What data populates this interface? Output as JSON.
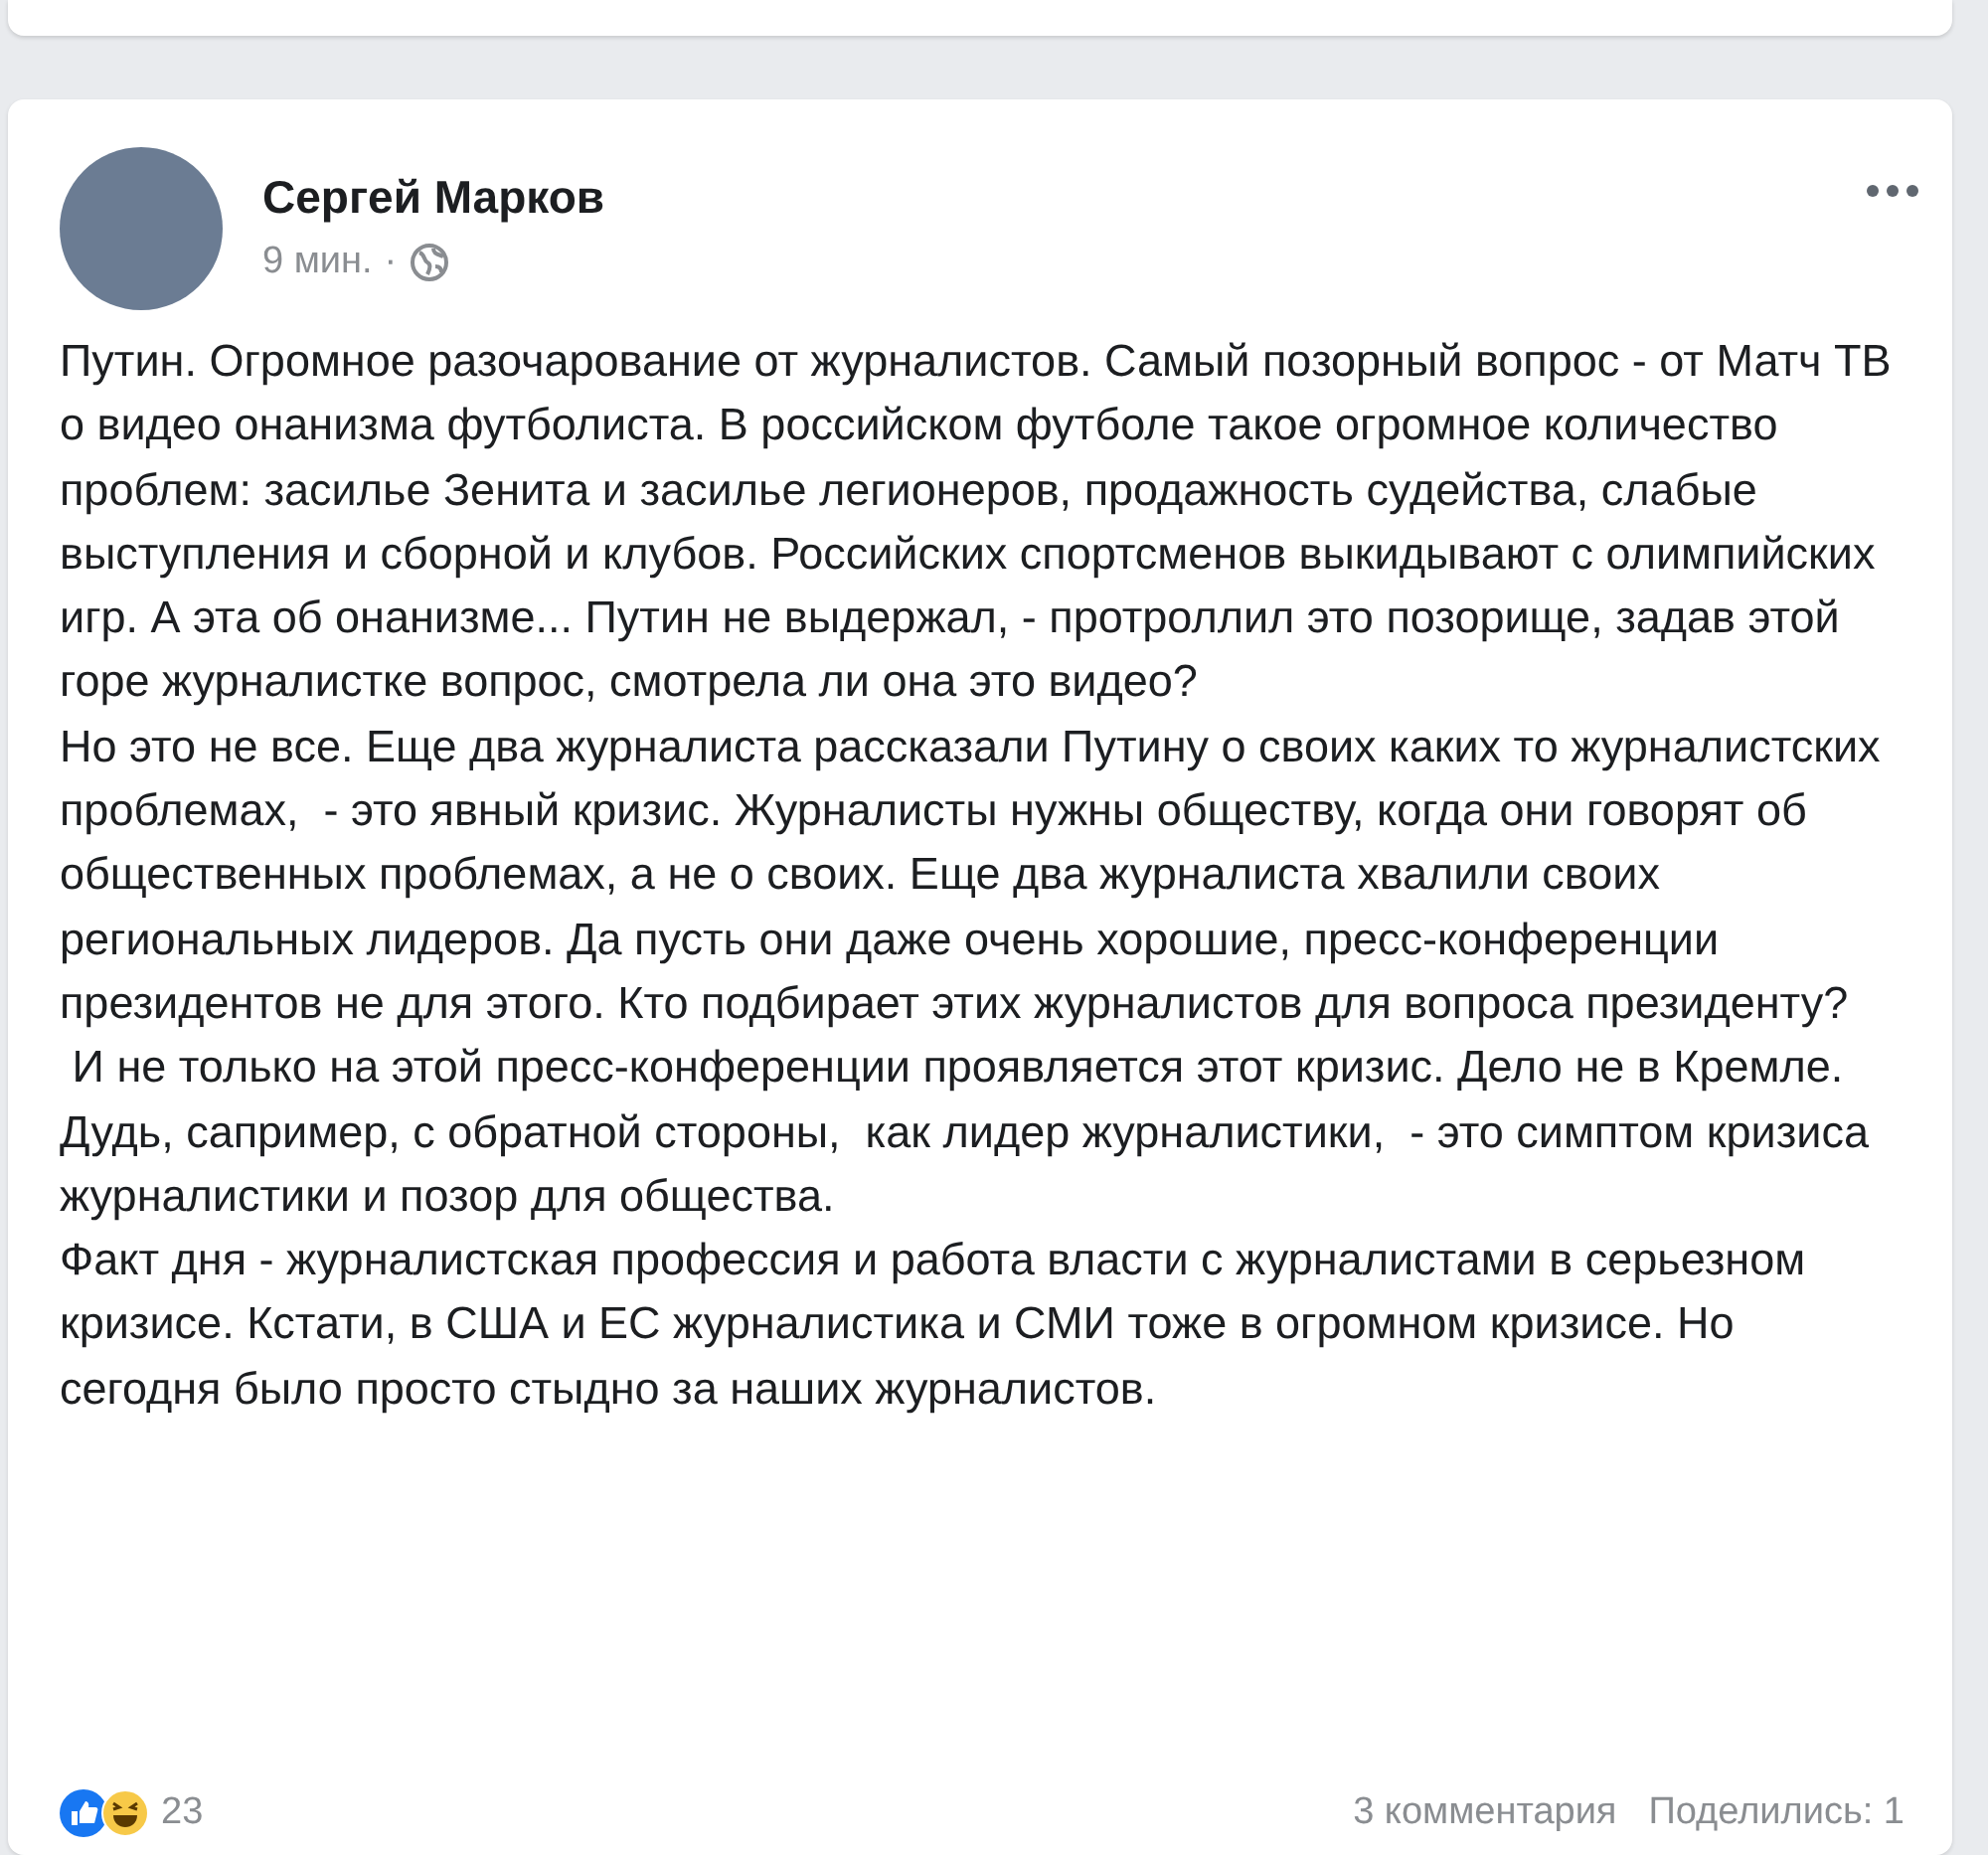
{
  "post": {
    "author": "Сергей Марков",
    "time": "9 мин.",
    "separator": "·",
    "paragraphs": [
      "Путин. Огромное разочарование от журналистов. Самый позорный вопрос - от Матч ТВ о видео онанизма футболиста. В российском футболе такое огромное количество проблем: засилье Зенита и засилье легионеров, продажность судейства, слабые выступления и сборной и клубов. Российских спортсменов выкидывают с олимпийских игр. А эта об онанизме... Путин не выдержал, - протроллил это позорище, задав этой горе журналистке вопрос, смотрела ли она это видео?",
      "Но это не все. Еще два журналиста рассказали Путину о своих каких то журналистских проблемах,  - это явный кризис. Журналисты нужны обществу, когда они говорят об общественных проблемах, а не о своих. Еще два журналиста хвалили своих региональных лидеров. Да пусть они даже очень хорошие, пресс-конференции президентов не для этого. Кто подбирает этих журналистов для вопроса президенту?",
      " И не только на этой пресс-конференции проявляется этот кризис. Дело не в Кремле. Дудь, сапример, с обратной стороны,  как лидер журналистики,  - это симптом кризиса журналистики и позор для общества.",
      "Факт дня - журналистская профессия и работа власти с журналистами в серьезном кризисе. Кстати, в США и ЕС журналистика и СМИ тоже в огромном кризисе. Но сегодня было просто стыдно за наших журналистов."
    ],
    "reactions_count": "23",
    "comments": "3 комментария",
    "shares": "Поделились: 1"
  }
}
